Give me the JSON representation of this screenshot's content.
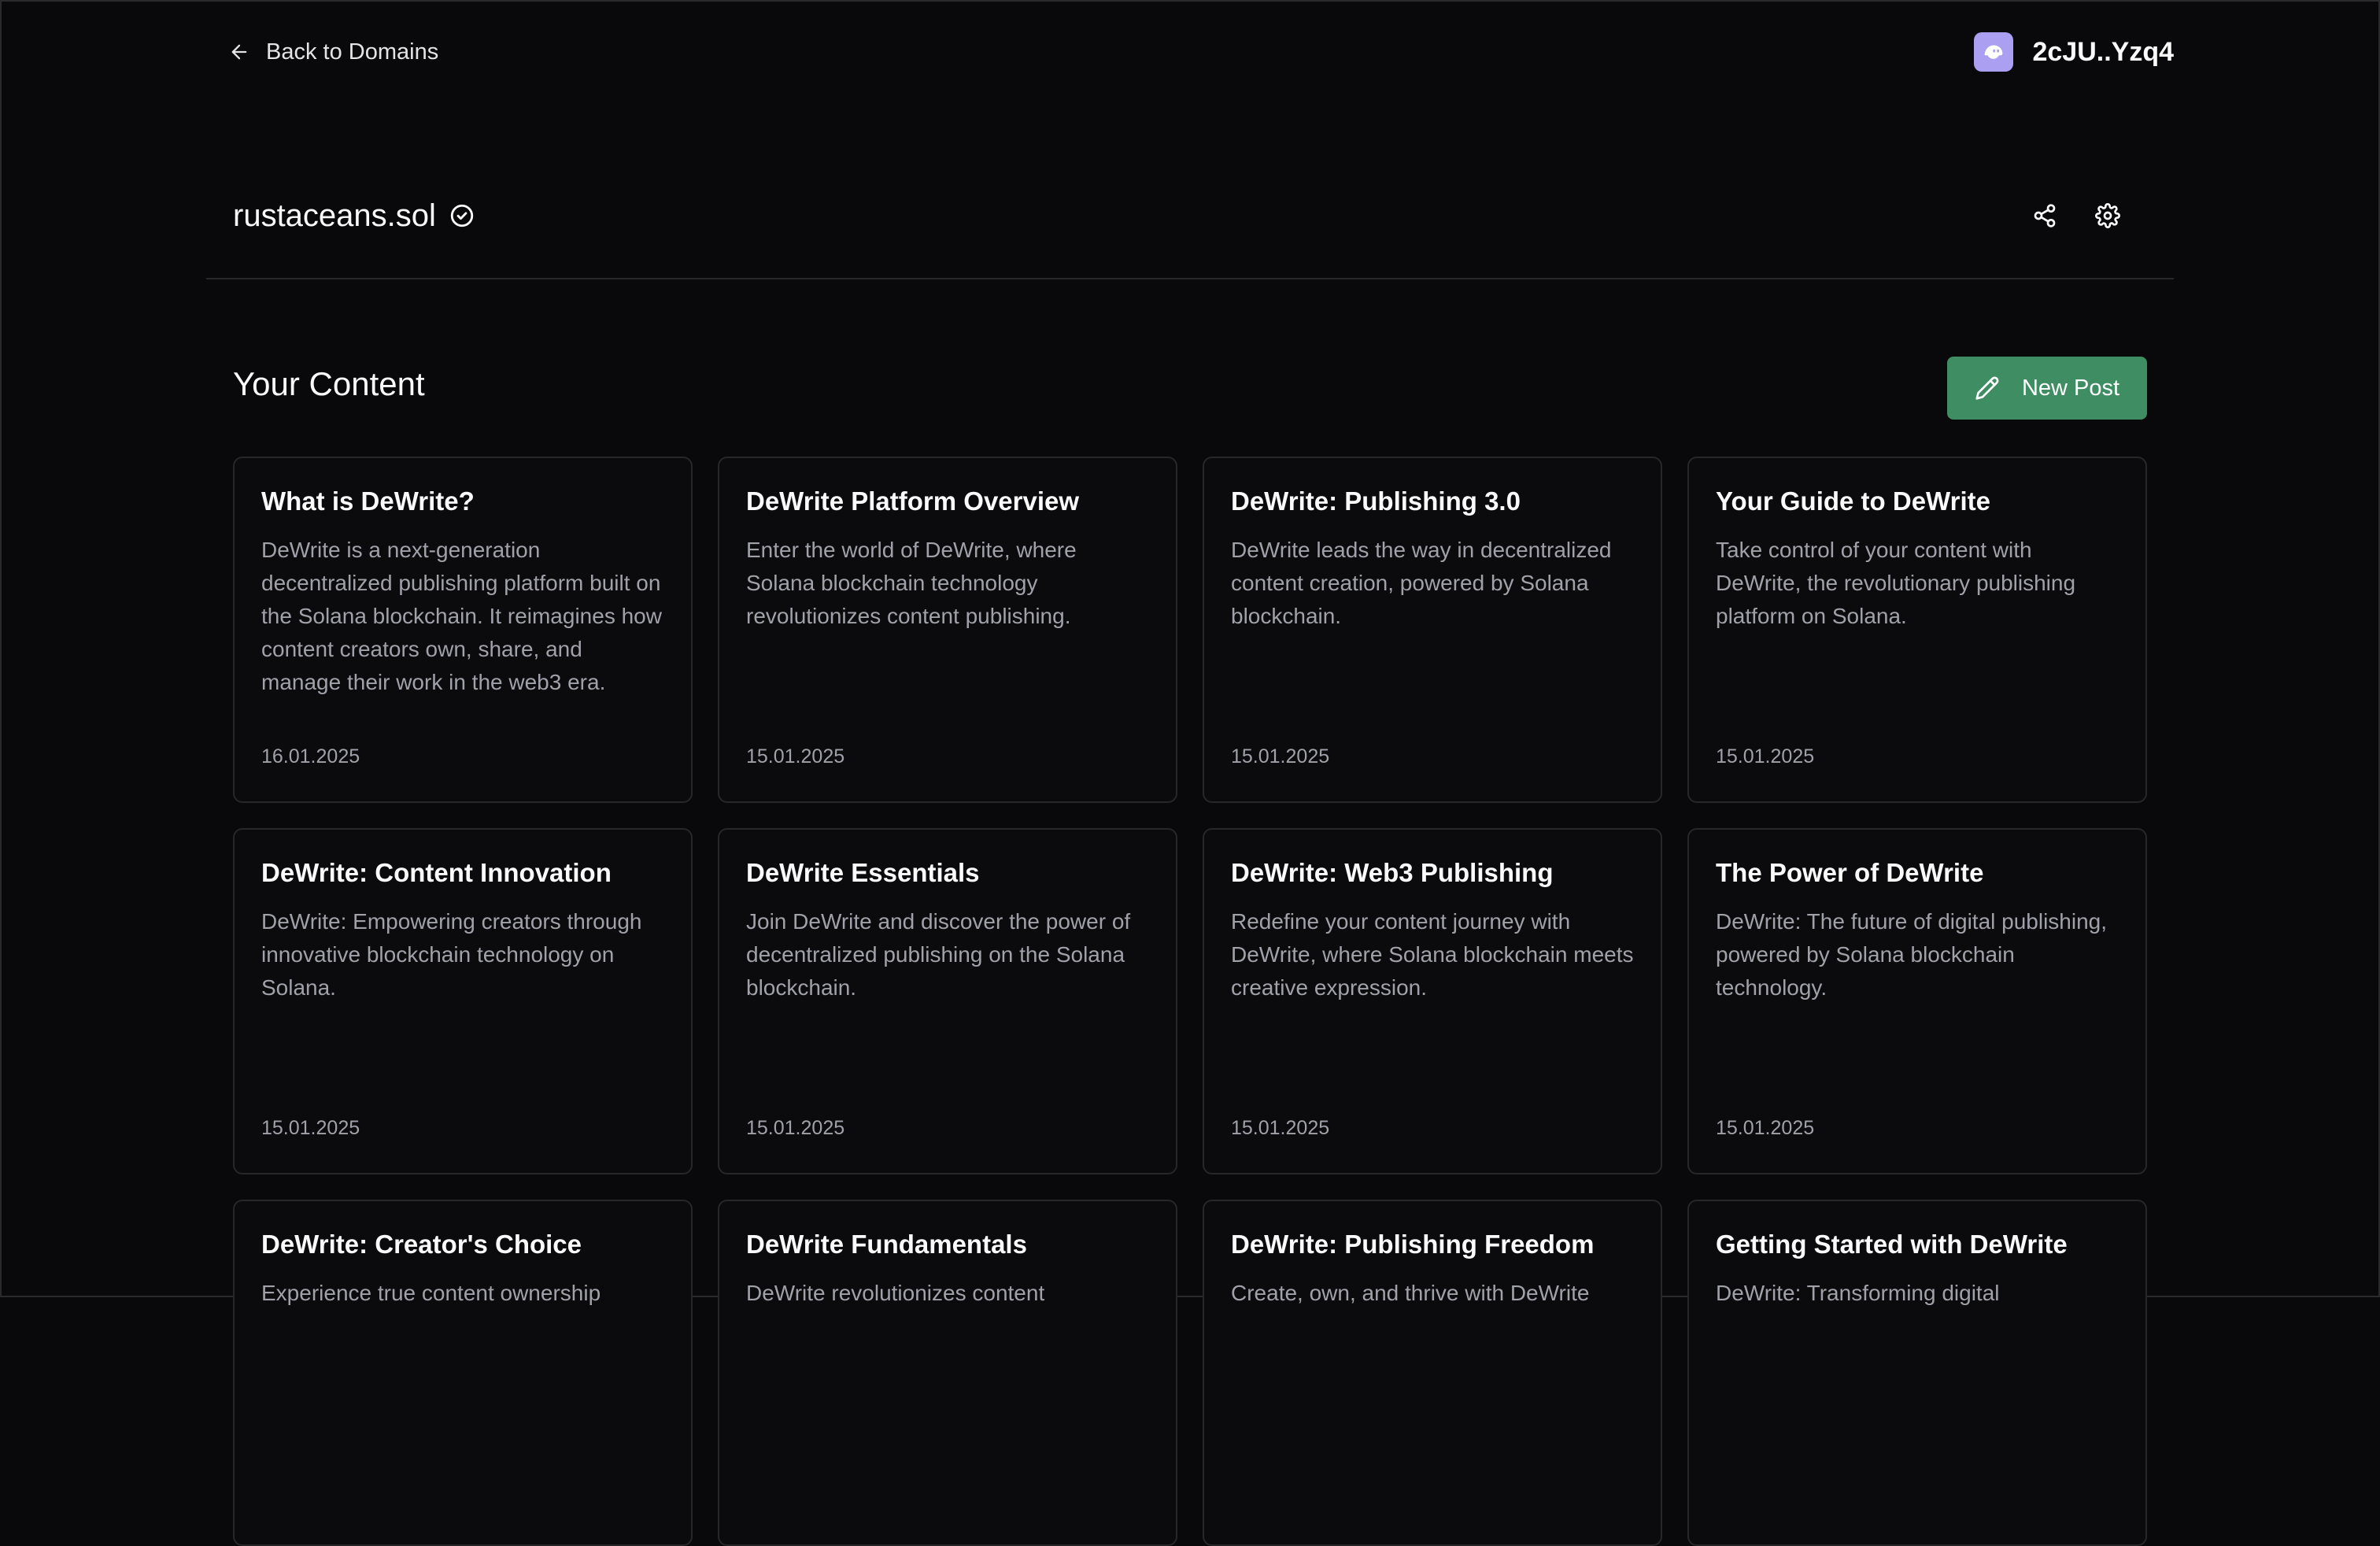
{
  "nav": {
    "back_label": "Back to Domains"
  },
  "wallet": {
    "address": "2cJU..Yzq4",
    "avatar_color": "#ab9ff2"
  },
  "domain": {
    "name": "rustaceans.sol"
  },
  "content": {
    "title": "Your Content",
    "new_post_label": "New Post",
    "accent_color": "#3f8e63",
    "posts": [
      {
        "title": "What is DeWrite?",
        "description": "DeWrite is a next-generation decentralized publishing platform built on the Solana blockchain. It reimagines how content creators own, share, and manage their work in the web3 era.",
        "date": "16.01.2025"
      },
      {
        "title": "DeWrite Platform Overview",
        "description": "Enter the world of DeWrite, where Solana blockchain technology revolutionizes content publishing.",
        "date": "15.01.2025"
      },
      {
        "title": "DeWrite: Publishing 3.0",
        "description": "DeWrite leads the way in decentralized content creation, powered by Solana blockchain.",
        "date": "15.01.2025"
      },
      {
        "title": "Your Guide to DeWrite",
        "description": "Take control of your content with DeWrite, the revolutionary publishing platform on Solana.",
        "date": "15.01.2025"
      },
      {
        "title": "DeWrite: Content Innovation",
        "description": "DeWrite: Empowering creators through innovative blockchain technology on Solana.",
        "date": "15.01.2025"
      },
      {
        "title": "DeWrite Essentials",
        "description": "Join DeWrite and discover the power of decentralized publishing on the Solana blockchain.",
        "date": "15.01.2025"
      },
      {
        "title": "DeWrite: Web3 Publishing",
        "description": "Redefine your content journey with DeWrite, where Solana blockchain meets creative expression.",
        "date": "15.01.2025"
      },
      {
        "title": "The Power of DeWrite",
        "description": "DeWrite: The future of digital publishing, powered by Solana blockchain technology.",
        "date": "15.01.2025"
      },
      {
        "title": "DeWrite: Creator's Choice",
        "description": "Experience true content ownership",
        "date": ""
      },
      {
        "title": "DeWrite Fundamentals",
        "description": "DeWrite revolutionizes content",
        "date": ""
      },
      {
        "title": "DeWrite: Publishing Freedom",
        "description": "Create, own, and thrive with DeWrite",
        "date": ""
      },
      {
        "title": "Getting Started with DeWrite",
        "description": "DeWrite: Transforming digital",
        "date": ""
      }
    ]
  }
}
